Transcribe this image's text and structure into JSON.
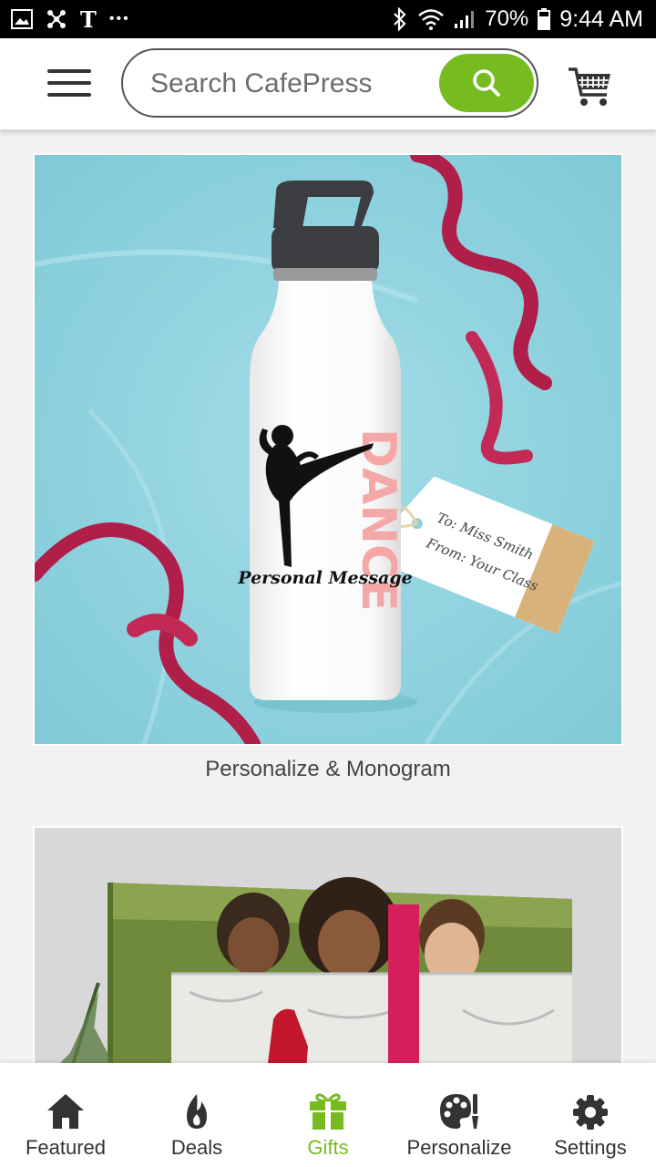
{
  "status_bar": {
    "carrier_icon": "T",
    "more_dots": "•••",
    "battery": "70%",
    "time": "9:44 AM"
  },
  "header": {
    "search_placeholder": "Search CafePress",
    "icons": [
      "menu-icon",
      "search-icon",
      "cart-icon"
    ]
  },
  "colors": {
    "accent": "#76bc21",
    "background": "#f2f2f2",
    "ribbon": "#b01e4a",
    "tissue": "#8fd1dd"
  },
  "cards": [
    {
      "caption": "Personalize & Monogram",
      "bottle": {
        "word": "DANCE",
        "message": "Personal Message"
      },
      "tag": {
        "line1": "To: Miss Smith",
        "line2": "From: Your Class"
      }
    },
    {
      "caption": ""
    }
  ],
  "bottom_nav": [
    {
      "label": "Featured",
      "icon": "home-icon"
    },
    {
      "label": "Deals",
      "icon": "flame-icon"
    },
    {
      "label": "Gifts",
      "icon": "gift-icon",
      "active": true
    },
    {
      "label": "Personalize",
      "icon": "palette-icon"
    },
    {
      "label": "Settings",
      "icon": "gear-icon"
    }
  ]
}
